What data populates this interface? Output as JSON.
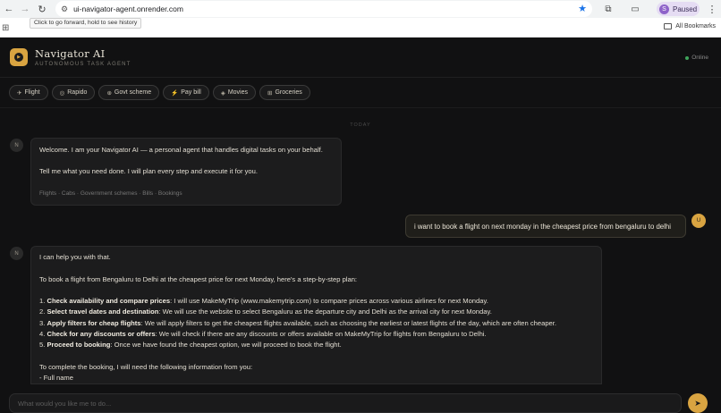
{
  "browser": {
    "url": "ui-navigator-agent.onrender.com",
    "tooltip": "Click to go forward, hold to see history",
    "profile_status": "Paused",
    "profile_initial": "S",
    "bookmarks_label": "All Bookmarks",
    "icons": {
      "back": "←",
      "forward": "→",
      "reload": "↻",
      "site_info": "⚙",
      "star": "★",
      "extensions": "⧉",
      "cast": "▭",
      "menu": "⋮",
      "apps": "⊞"
    }
  },
  "app": {
    "title": "Navigator AI",
    "subtitle": "AUTONOMOUS TASK AGENT",
    "status": "Online",
    "chips": [
      {
        "icon": "✈",
        "label": "Flight"
      },
      {
        "icon": "◎",
        "label": "Rapido"
      },
      {
        "icon": "⊕",
        "label": "Govt scheme"
      },
      {
        "icon": "⚡",
        "label": "Pay bill"
      },
      {
        "icon": "◈",
        "label": "Movies"
      },
      {
        "icon": "⊞",
        "label": "Groceries"
      }
    ],
    "date_divider": "TODAY"
  },
  "messages": {
    "bot_avatar": "N",
    "user_avatar": "U",
    "welcome": {
      "line1": "Welcome. I am your Navigator AI — a personal agent that handles digital tasks on your behalf.",
      "line2": "Tell me what you need done. I will plan every step and execute it for you.",
      "tags": "Flights · Cabs · Government schemes · Bills · Bookings"
    },
    "user_message": "i want to book a flight on next monday in the cheapest price from bengaluru to delhi",
    "reply": {
      "intro": "I can help you with that.",
      "summary": "To book a flight from Bengaluru to Delhi at the cheapest price for next Monday, here's a step-by-step plan:",
      "steps": [
        {
          "num": "1.",
          "title": "Check availability and compare prices",
          "text": ": I will use MakeMyTrip (www.makemytrip.com) to compare prices across various airlines for next Monday."
        },
        {
          "num": "2.",
          "title": "Select travel dates and destination",
          "text": ": We will use the website to select Bengaluru as the departure city and Delhi as the arrival city for next Monday."
        },
        {
          "num": "3.",
          "title": "Apply filters for cheap flights",
          "text": ": We will apply filters to get the cheapest flights available, such as choosing the earliest or latest flights of the day, which are often cheaper."
        },
        {
          "num": "4.",
          "title": "Check for any discounts or offers",
          "text": ": We will check if there are any discounts or offers available on MakeMyTrip for flights from Bengaluru to Delhi."
        },
        {
          "num": "5.",
          "title": "Proceed to booking",
          "text": ": Once we have found the cheapest option, we will proceed to book the flight."
        }
      ],
      "info_request": "To complete the booking, I will need the following information from you:",
      "info_item": "- Full name"
    }
  },
  "composer": {
    "placeholder": "What would you like me to do...",
    "send_icon": "➤"
  },
  "colors": {
    "accent": "#d9a441",
    "background": "#111112",
    "bubble": "#1c1c1d",
    "online": "#3fa55b"
  }
}
